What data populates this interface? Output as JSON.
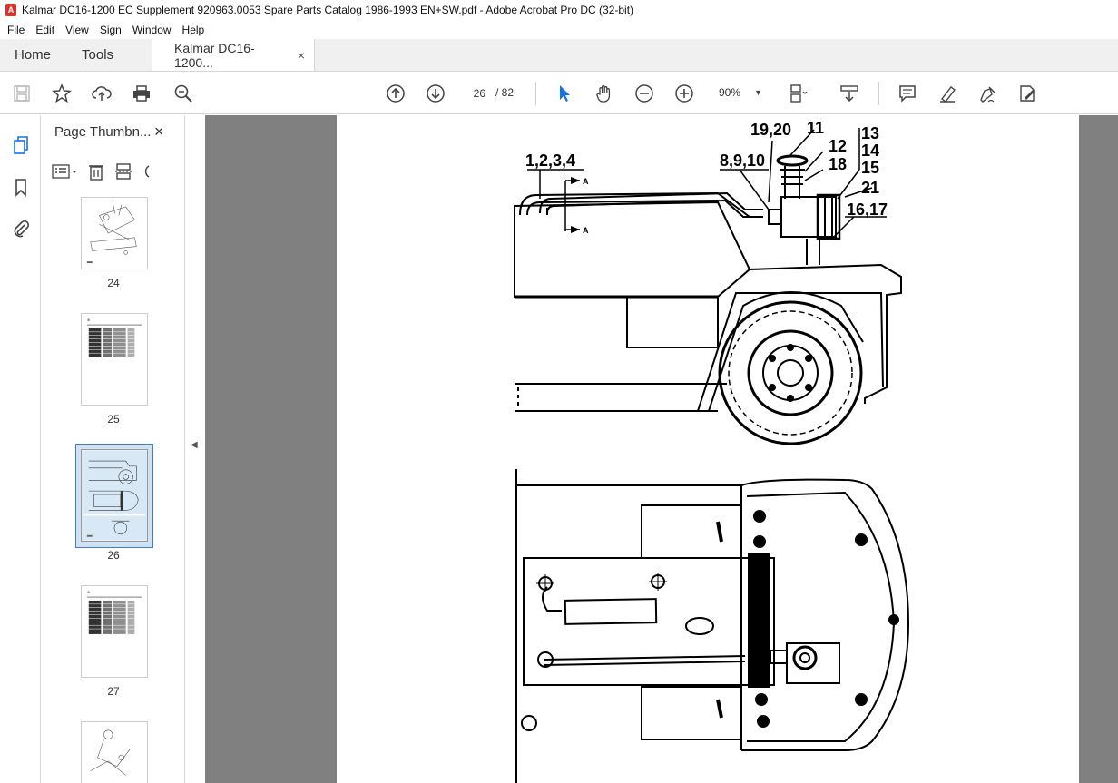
{
  "window": {
    "title": "Kalmar DC16-1200 EC Supplement 920963.0053 Spare Parts Catalog 1986-1993 EN+SW.pdf - Adobe Acrobat Pro DC (32-bit)"
  },
  "menu": [
    "File",
    "Edit",
    "View",
    "Sign",
    "Window",
    "Help"
  ],
  "tabs": {
    "home": "Home",
    "tools": "Tools",
    "document": "Kalmar DC16-1200...",
    "close": "×"
  },
  "toolbar": {
    "current_page": "26",
    "page_total": "/ 82",
    "zoom": "90%"
  },
  "panel": {
    "title": "Page Thumbn...",
    "close": "×",
    "thumbnails": [
      {
        "label": "24",
        "type": "drawing",
        "selected": false
      },
      {
        "label": "25",
        "type": "table",
        "selected": false
      },
      {
        "label": "26",
        "type": "drawing",
        "selected": true
      },
      {
        "label": "27",
        "type": "table",
        "selected": false
      },
      {
        "label": "",
        "type": "drawing",
        "selected": false
      }
    ]
  },
  "drawing": {
    "callouts": [
      "1,2,3,4",
      "8,9,10",
      "19,20",
      "11",
      "12",
      "18",
      "13",
      "14",
      "15",
      "21",
      "16,17",
      "A",
      "A"
    ]
  },
  "colors": {
    "accent": "#3f7fc1",
    "viewer_bg": "#808080",
    "select_tool": "#1473e6"
  }
}
